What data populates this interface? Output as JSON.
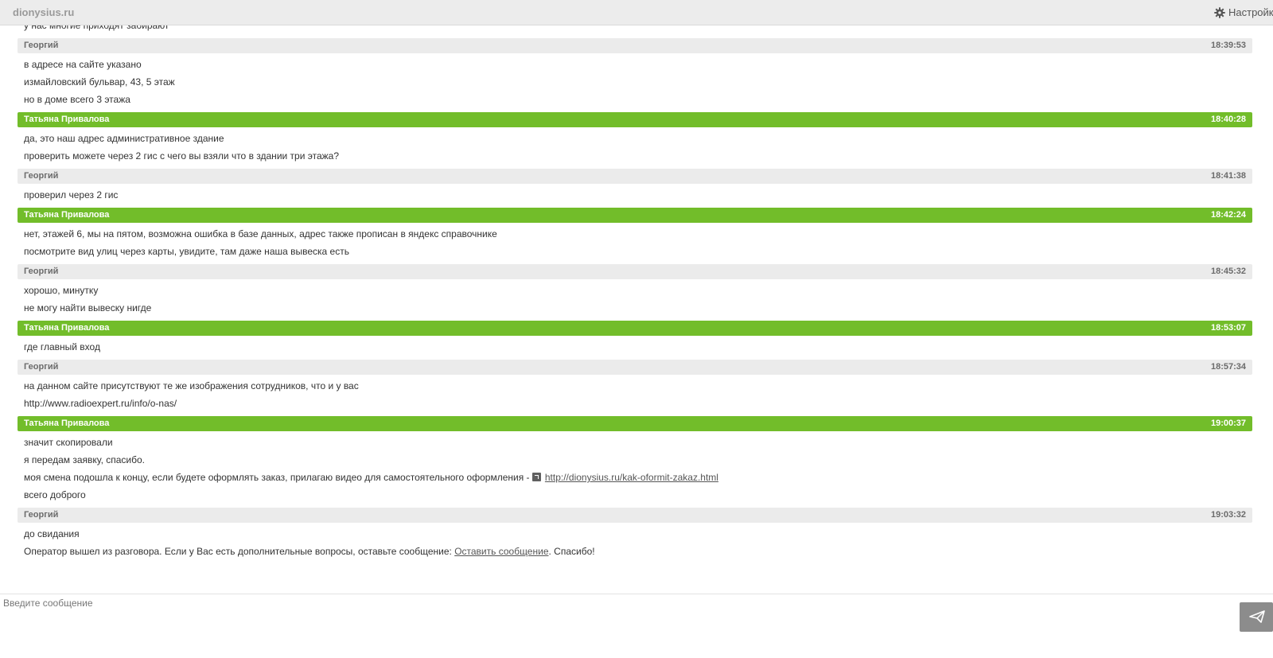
{
  "header": {
    "brand": "dionysius.ru",
    "settings_label": "Настройки",
    "settings_icon": "gear-icon"
  },
  "partial_top_line": "у нас многие приходят забирают",
  "messages": [
    {
      "author": "Георгий",
      "time": "18:39:53",
      "role": "customer",
      "lines": [
        {
          "text": "в адресе на сайте указано"
        },
        {
          "text": "измайловский бульвар, 43, 5 этаж"
        },
        {
          "text": "но в доме всего 3 этажа"
        }
      ]
    },
    {
      "author": "Татьяна Привалова",
      "time": "18:40:28",
      "role": "operator",
      "lines": [
        {
          "text": "да, это наш адрес административное здание"
        },
        {
          "text": "проверить можете через 2 гис с чего вы взяли что в здании три этажа?"
        }
      ]
    },
    {
      "author": "Георгий",
      "time": "18:41:38",
      "role": "customer",
      "lines": [
        {
          "text": "проверил через 2 гис"
        }
      ]
    },
    {
      "author": "Татьяна Привалова",
      "time": "18:42:24",
      "role": "operator",
      "lines": [
        {
          "text": "нет, этажей 6, мы на пятом, возможна ошибка в базе данных, адрес также прописан в яндекс справочнике"
        },
        {
          "text": "посмотрите вид улиц через карты, увидите, там даже наша вывеска есть"
        }
      ]
    },
    {
      "author": "Георгий",
      "time": "18:45:32",
      "role": "customer",
      "lines": [
        {
          "text": "хорошо, минутку"
        },
        {
          "text": "не могу найти вывеску нигде"
        }
      ]
    },
    {
      "author": "Татьяна Привалова",
      "time": "18:53:07",
      "role": "operator",
      "lines": [
        {
          "text": "где главный вход"
        }
      ]
    },
    {
      "author": "Георгий",
      "time": "18:57:34",
      "role": "customer",
      "lines": [
        {
          "text": "на данном сайте присутствуют те же изображения сотрудников, что и у вас"
        },
        {
          "text": "http://www.radioexpert.ru/info/o-nas/"
        }
      ]
    },
    {
      "author": "Татьяна Привалова",
      "time": "19:00:37",
      "role": "operator",
      "lines": [
        {
          "text": "значит скопировали"
        },
        {
          "text": "я передам заявку, спасибо."
        },
        {
          "text": "моя смена подошла к концу, если будете оформлять заказ, прилагаю видео для самостоятельного оформления - ",
          "link": "http://dionysius.ru/kak-oformit-zakaz.html"
        },
        {
          "text": "всего доброго"
        }
      ]
    },
    {
      "author": "Георгий",
      "time": "19:03:32",
      "role": "customer",
      "lines": [
        {
          "text": "до свидания"
        },
        {
          "text": "Оператор вышел из разговора. Если у Вас есть дополнительные вопросы, оставьте сообщение: ",
          "link": "Оставить сообщение",
          "after": ". Спасибо!"
        }
      ]
    }
  ],
  "composer": {
    "placeholder": "Введите сообщение",
    "send_icon": "paper-plane-icon"
  },
  "colors": {
    "operator_header": "#72bd2a",
    "customer_header": "#ebebeb",
    "send_button": "#8c8c8c"
  }
}
